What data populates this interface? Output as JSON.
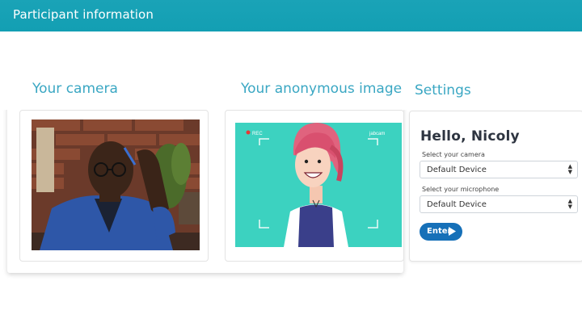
{
  "header": {
    "title": "Participant information"
  },
  "sections": {
    "camera_title": "Your camera",
    "anon_title": "Your anonymous image",
    "settings_title": "Settings"
  },
  "avatar_overlay": {
    "rec_label": "REC",
    "brand": "jabcam"
  },
  "settings": {
    "greeting": "Hello, Nicoly",
    "camera_label": "Select your camera",
    "camera_value": "Default Device",
    "mic_label": "Select your microphone",
    "mic_value": "Default Device",
    "enter_label": "Enter"
  },
  "colors": {
    "header": "#17a2b8",
    "accent_title": "#3aa7c3",
    "enter_button": "#1670b8",
    "avatar_bg": "#3cd2c0"
  },
  "icons": [
    "play-icon",
    "updown-arrows-icon"
  ]
}
